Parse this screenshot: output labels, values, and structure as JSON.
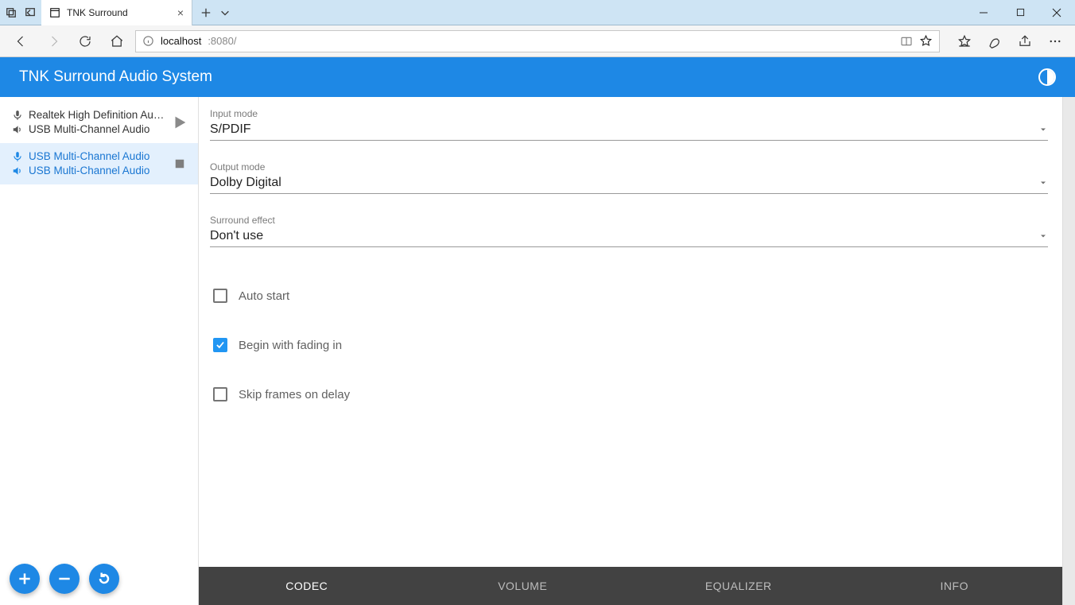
{
  "browser": {
    "tab_title": "TNK Surround",
    "url_host": "localhost",
    "url_port": ":8080/"
  },
  "header": {
    "title": "TNK Surround Audio System"
  },
  "sidebar": {
    "devices": [
      {
        "input": "Realtek High Definition Au…",
        "output": "USB Multi-Channel Audio",
        "action": "play",
        "selected": false
      },
      {
        "input": "USB Multi-Channel Audio",
        "output": "USB Multi-Channel Audio",
        "action": "stop",
        "selected": true
      }
    ]
  },
  "fields": {
    "input_mode": {
      "label": "Input mode",
      "value": "S/PDIF"
    },
    "output_mode": {
      "label": "Output mode",
      "value": "Dolby Digital"
    },
    "surround_effect": {
      "label": "Surround effect",
      "value": "Don't use"
    }
  },
  "checks": {
    "auto_start": {
      "label": "Auto start",
      "checked": false
    },
    "fade": {
      "label": "Begin with fading in",
      "checked": true
    },
    "skip": {
      "label": "Skip frames on delay",
      "checked": false
    }
  },
  "tabs": {
    "codec": "CODEC",
    "volume": "VOLUME",
    "equalizer": "EQUALIZER",
    "info": "INFO",
    "active": "codec"
  }
}
